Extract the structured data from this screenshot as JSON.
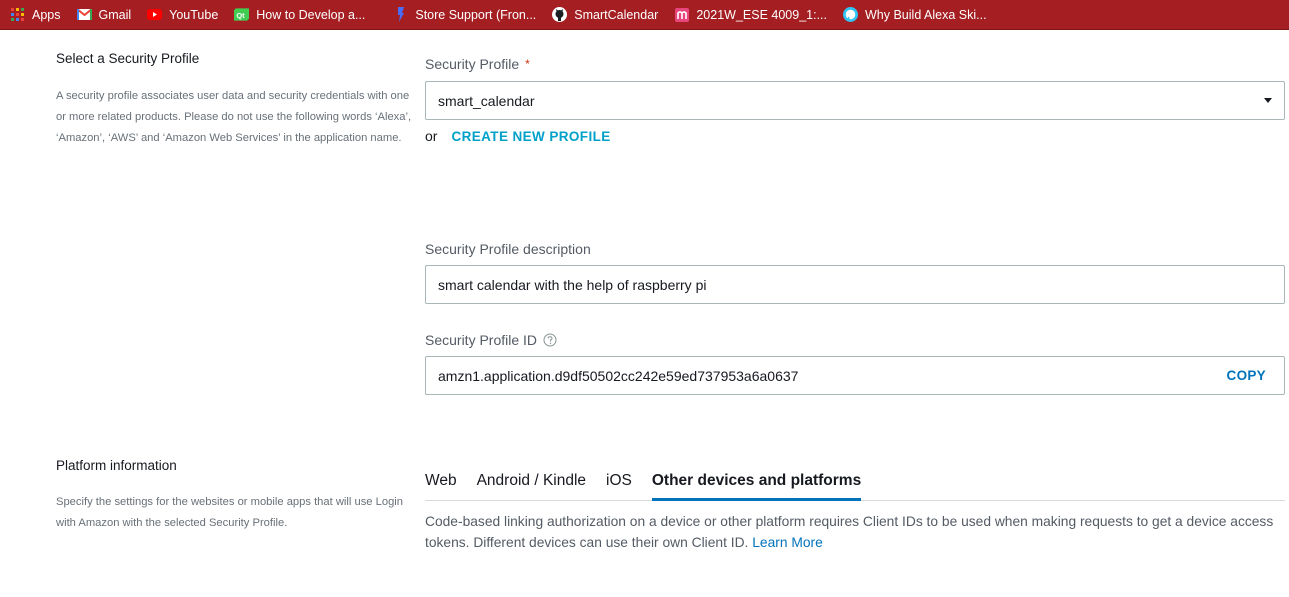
{
  "bookmarks": [
    {
      "icon": "apps-grid-icon",
      "label": "Apps"
    },
    {
      "icon": "gmail-icon",
      "label": "Gmail"
    },
    {
      "icon": "youtube-icon",
      "label": "YouTube"
    },
    {
      "icon": "qt-icon",
      "label": "How to Develop a..."
    },
    {
      "icon": "store-support-icon",
      "label": "Store Support (Fron..."
    },
    {
      "icon": "github-icon",
      "label": "SmartCalendar"
    },
    {
      "icon": "moodle-icon",
      "label": "2021W_ESE 4009_1:..."
    },
    {
      "icon": "alexa-icon",
      "label": "Why Build Alexa Ski..."
    }
  ],
  "security_section": {
    "title": "Select a Security Profile",
    "description": "A security profile associates user data and security credentials with one or more related products. Please do not use the following words ‘Alexa’, ‘Amazon’, ‘AWS’ and ‘Amazon Web Services’ in the application name."
  },
  "security_profile": {
    "label": "Security Profile",
    "required_mark": "*",
    "selected_value": "smart_calendar",
    "or_text": "or",
    "create_new_label": "CREATE NEW PROFILE"
  },
  "profile_description": {
    "label": "Security Profile description",
    "value": "smart calendar with the help of raspberry pi"
  },
  "profile_id": {
    "label": "Security Profile ID",
    "value": "amzn1.application.d9df50502cc242e59ed737953a6a0637",
    "copy_label": "COPY"
  },
  "platform_section": {
    "title": "Platform information",
    "description": "Specify the settings for the websites or mobile apps that will use Login with Amazon with the selected Security Profile."
  },
  "platform_tabs": [
    {
      "label": "Web",
      "active": false
    },
    {
      "label": "Android / Kindle",
      "active": false
    },
    {
      "label": "iOS",
      "active": false
    },
    {
      "label": "Other devices and platforms",
      "active": true
    }
  ],
  "platform_tab_content": {
    "text": "Code-based linking authorization on a device or other platform requires Client IDs to be used when making requests to get a device access tokens. Different devices can use their own Client ID.",
    "link_label": "Learn More"
  },
  "colors": {
    "bookmark_bar": "#a41e22",
    "link": "#0073bb",
    "create_link": "#00a1c9",
    "required": "#d13212"
  }
}
